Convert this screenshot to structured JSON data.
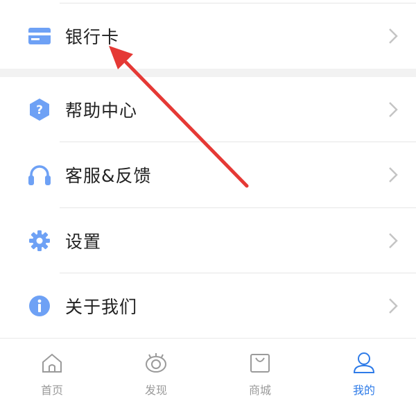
{
  "menu": {
    "items": [
      {
        "label": "银行卡",
        "icon": "bank-card-icon"
      },
      {
        "label": "帮助中心",
        "icon": "help-question-icon"
      },
      {
        "label": "客服&反馈",
        "icon": "headphones-icon"
      },
      {
        "label": "设置",
        "icon": "gear-icon"
      },
      {
        "label": "关于我们",
        "icon": "info-icon"
      }
    ]
  },
  "tabbar": {
    "tabs": [
      {
        "label": "首页",
        "icon": "home-icon"
      },
      {
        "label": "发现",
        "icon": "discover-eye-icon"
      },
      {
        "label": "商城",
        "icon": "shopping-bag-icon"
      },
      {
        "label": "我的",
        "icon": "user-icon",
        "active": true
      }
    ]
  },
  "colors": {
    "icon_blue": "#6ea1f5",
    "active_blue": "#2e7be8",
    "annotation_red": "#e53935",
    "chevron": "#c4c4c4"
  }
}
